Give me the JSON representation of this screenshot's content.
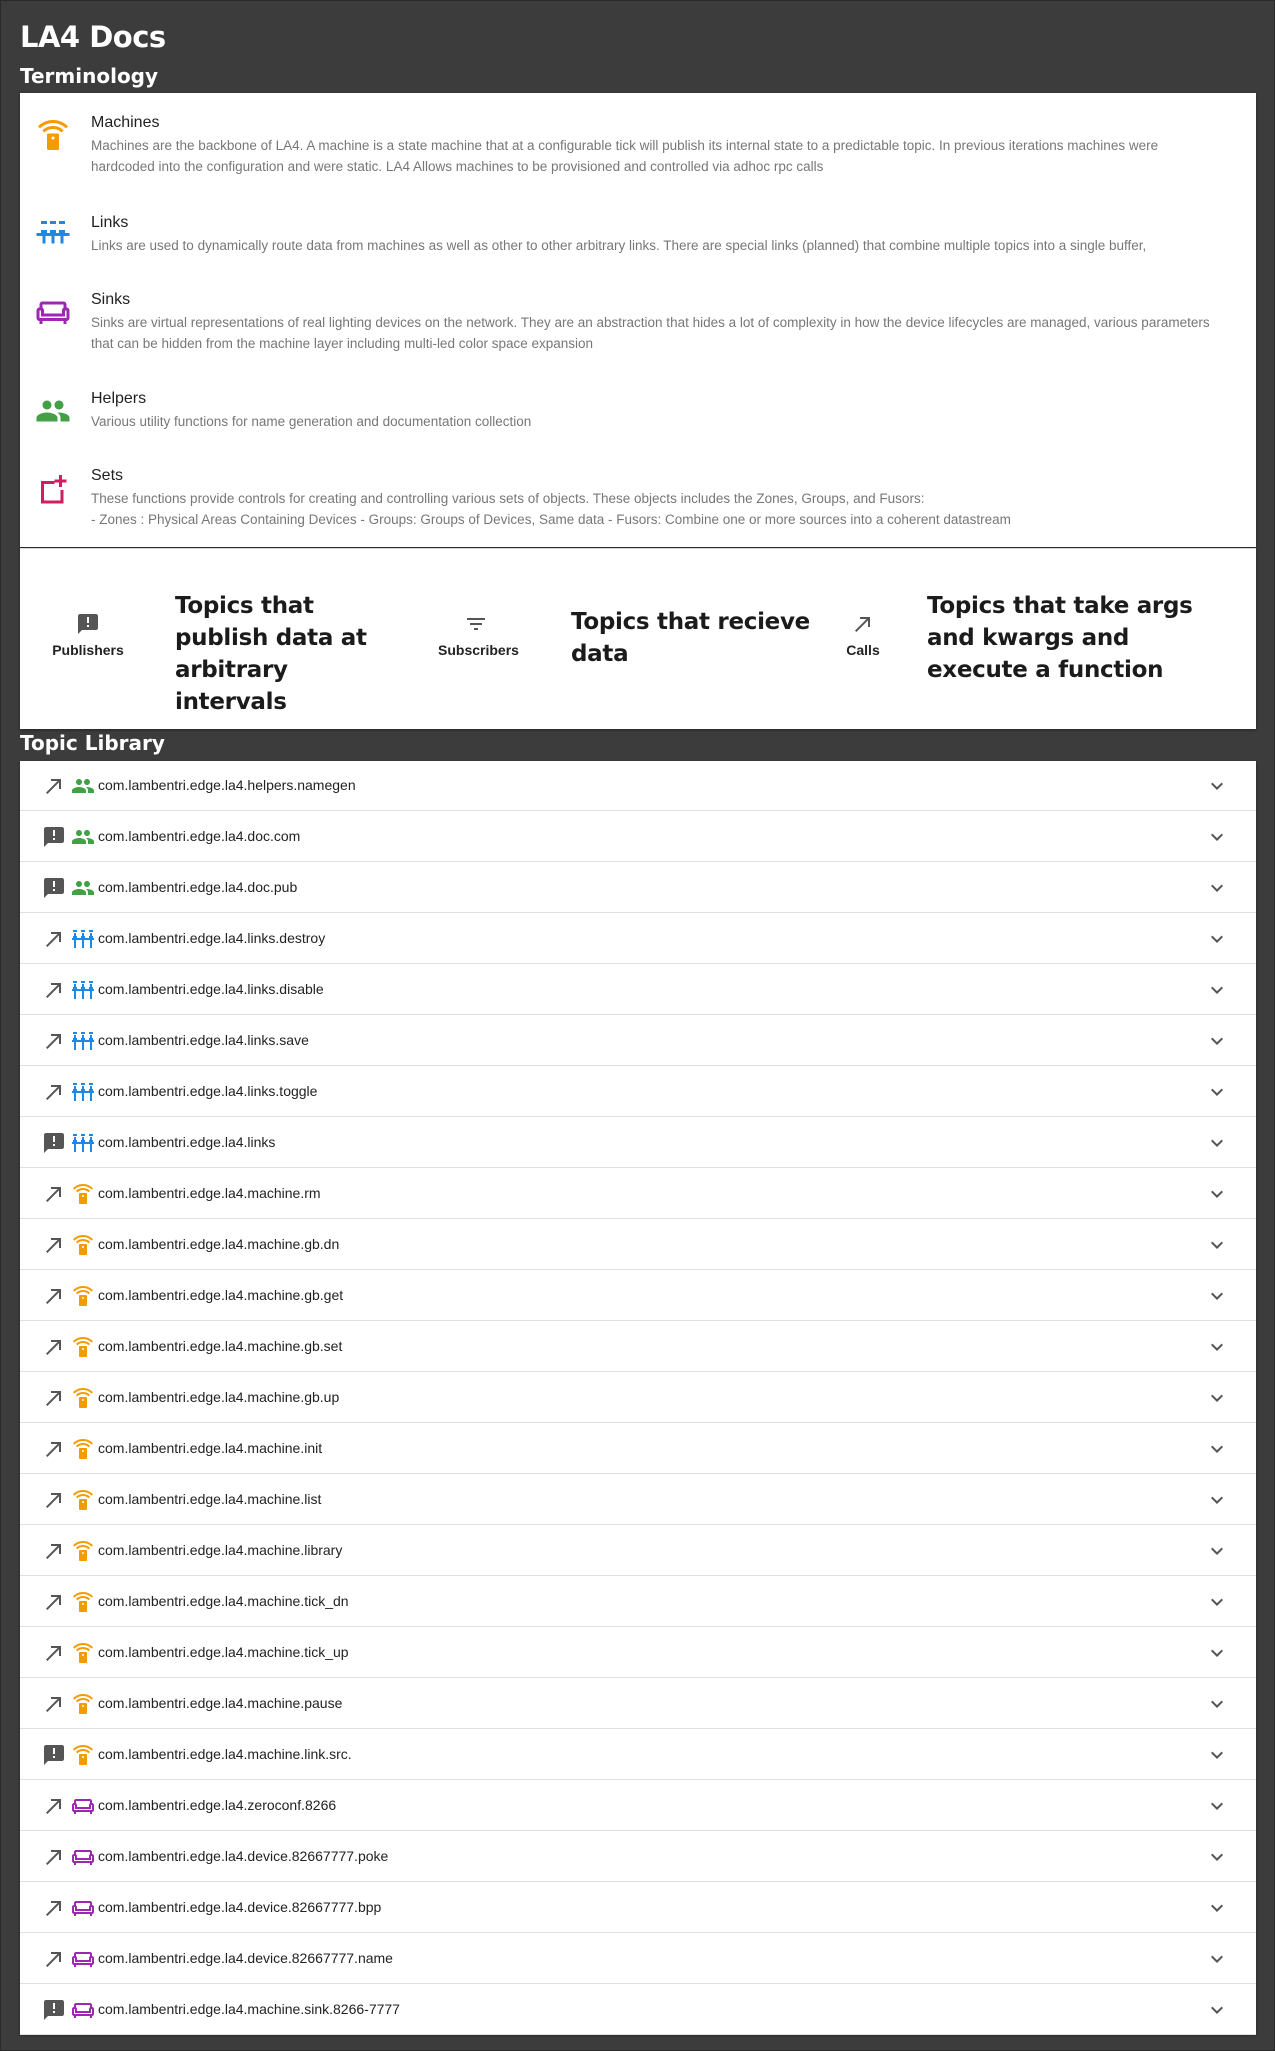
{
  "app": {
    "title": "LA4 Docs"
  },
  "terminology": {
    "title": "Terminology",
    "items": [
      {
        "name": "Machines",
        "icon": "machine-icon",
        "color": "#f59b00",
        "desc": "Machines are the backbone of LA4. A machine is a state machine that at a configurable tick will publish its internal state to a predictable topic. In previous iterations machines were hardcoded into the configuration and were static. LA4 Allows machines to be provisioned and controlled via adhoc rpc calls"
      },
      {
        "name": "Links",
        "icon": "links-icon",
        "color": "#1e88e5",
        "desc": "Links are used to dynamically route data from machines as well as other to other arbitrary links. There are special links (planned) that combine multiple topics into a single buffer,"
      },
      {
        "name": "Sinks",
        "icon": "sink-icon",
        "color": "#9c27b0",
        "desc": "Sinks are virtual representations of real lighting devices on the network. They are an abstraction that hides a lot of complexity in how the device lifecycles are managed, various parameters that can be hidden from the machine layer including multi-led color space expansion"
      },
      {
        "name": "Helpers",
        "icon": "people-icon",
        "color": "#43a047",
        "desc": "Various utility functions for name generation and documentation collection"
      },
      {
        "name": "Sets",
        "icon": "add-to-queue-icon",
        "color": "#d81b60",
        "desc": "These functions provide controls for creating and controlling various sets of objects. These objects includes the Zones, Groups, and Fusors:",
        "desc2": "- Zones : Physical Areas Containing Devices - Groups: Groups of Devices, Same data - Fusors: Combine one or more sources into a coherent datastream"
      }
    ]
  },
  "legend": [
    {
      "label": "Publishers",
      "icon": "announcement-icon",
      "text": "Topics that publish data at arbitrary intervals"
    },
    {
      "label": "Subscribers",
      "icon": "filter-icon",
      "text": "Topics that recieve data"
    },
    {
      "label": "Calls",
      "icon": "call-made-icon",
      "text": "Topics that take args and kwargs and execute a function"
    }
  ],
  "library": {
    "title": "Topic Library",
    "topics": [
      {
        "kind": "call",
        "category": "helpers",
        "name": "com.lambentri.edge.la4.helpers.namegen"
      },
      {
        "kind": "pub",
        "category": "helpers",
        "name": "com.lambentri.edge.la4.doc.com"
      },
      {
        "kind": "pub",
        "category": "helpers",
        "name": "com.lambentri.edge.la4.doc.pub"
      },
      {
        "kind": "call",
        "category": "links",
        "name": "com.lambentri.edge.la4.links.destroy"
      },
      {
        "kind": "call",
        "category": "links",
        "name": "com.lambentri.edge.la4.links.disable"
      },
      {
        "kind": "call",
        "category": "links",
        "name": "com.lambentri.edge.la4.links.save"
      },
      {
        "kind": "call",
        "category": "links",
        "name": "com.lambentri.edge.la4.links.toggle"
      },
      {
        "kind": "pub",
        "category": "links",
        "name": "com.lambentri.edge.la4.links"
      },
      {
        "kind": "call",
        "category": "machine",
        "name": "com.lambentri.edge.la4.machine.rm"
      },
      {
        "kind": "call",
        "category": "machine",
        "name": "com.lambentri.edge.la4.machine.gb.dn"
      },
      {
        "kind": "call",
        "category": "machine",
        "name": "com.lambentri.edge.la4.machine.gb.get"
      },
      {
        "kind": "call",
        "category": "machine",
        "name": "com.lambentri.edge.la4.machine.gb.set"
      },
      {
        "kind": "call",
        "category": "machine",
        "name": "com.lambentri.edge.la4.machine.gb.up"
      },
      {
        "kind": "call",
        "category": "machine",
        "name": "com.lambentri.edge.la4.machine.init"
      },
      {
        "kind": "call",
        "category": "machine",
        "name": "com.lambentri.edge.la4.machine.list"
      },
      {
        "kind": "call",
        "category": "machine",
        "name": "com.lambentri.edge.la4.machine.library"
      },
      {
        "kind": "call",
        "category": "machine",
        "name": "com.lambentri.edge.la4.machine.tick_dn"
      },
      {
        "kind": "call",
        "category": "machine",
        "name": "com.lambentri.edge.la4.machine.tick_up"
      },
      {
        "kind": "call",
        "category": "machine",
        "name": "com.lambentri.edge.la4.machine.pause"
      },
      {
        "kind": "pub",
        "category": "machine",
        "name": "com.lambentri.edge.la4.machine.link.src."
      },
      {
        "kind": "call",
        "category": "sink",
        "name": "com.lambentri.edge.la4.zeroconf.8266"
      },
      {
        "kind": "call",
        "category": "sink",
        "name": "com.lambentri.edge.la4.device.82667777.poke"
      },
      {
        "kind": "call",
        "category": "sink",
        "name": "com.lambentri.edge.la4.device.82667777.bpp"
      },
      {
        "kind": "call",
        "category": "sink",
        "name": "com.lambentri.edge.la4.device.82667777.name"
      },
      {
        "kind": "pub",
        "category": "sink",
        "name": "com.lambentri.edge.la4.machine.sink.8266-7777"
      }
    ]
  }
}
